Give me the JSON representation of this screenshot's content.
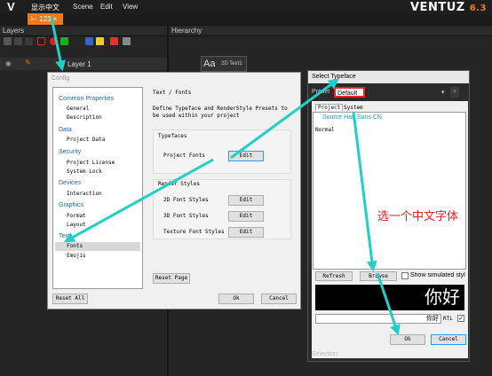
{
  "app": {
    "menu": [
      "显示中文",
      "Scene",
      "Edit",
      "View"
    ],
    "brand": "VENTUZ",
    "version": "6.3",
    "tab_label": "123",
    "tab_close": "×"
  },
  "layers_panel": {
    "title": "Layers",
    "layer_name": "Layer 1"
  },
  "hierarchy_panel": {
    "title": "Hierarchy",
    "node_icon": "Aa",
    "node_label": "2D Text1"
  },
  "config_dialog": {
    "title": "Config",
    "tree": [
      {
        "label": "Common Properties",
        "children": [
          "General",
          "Description"
        ]
      },
      {
        "label": "Data",
        "children": [
          "Project Data"
        ]
      },
      {
        "label": "Security",
        "children": [
          "Project License",
          "System Lock"
        ]
      },
      {
        "label": "Devices",
        "children": [
          "Interaction"
        ]
      },
      {
        "label": "Graphics",
        "children": [
          "Format",
          "Layout"
        ]
      },
      {
        "label": "Text",
        "children": [
          "Fonts",
          "Emojis"
        ]
      }
    ],
    "heading": "Text / Fonts",
    "description": "Define Typeface and RenderStyle Presets to be used within your project",
    "typefaces_label": "Typefaces",
    "project_fonts_label": "Project Fonts",
    "render_styles_label": "Render Styles",
    "rows": [
      "2D Font Styles",
      "3D Font Styles",
      "Texture Font Styles"
    ],
    "edit_label": "Edit",
    "reset_page": "Reset Page",
    "reset_all": "Reset All",
    "ok": "Ok",
    "cancel": "Cancel"
  },
  "typeface_dialog": {
    "title": "Select Typeface",
    "preset_label": "Preset",
    "preset_value": "Default",
    "tabs": [
      "Project",
      "System"
    ],
    "selected_font": "Source Han Sans CN",
    "style": "Normal",
    "refresh": "Refresh",
    "browse": "Browse",
    "show_simulated": "Show simulated styl",
    "preview_text": "你好",
    "sample_value": "你好",
    "rtl": "RTL",
    "ok": "Ok",
    "cancel": "Cancel",
    "selection_label": "Selection:"
  },
  "annotation": {
    "text": "选一个中文字体",
    "color": "#e22222"
  },
  "colors": {
    "accent": "#f07a1a",
    "arrow": "#20d0c8",
    "highlight": "#e22222",
    "link": "#2266aa"
  }
}
